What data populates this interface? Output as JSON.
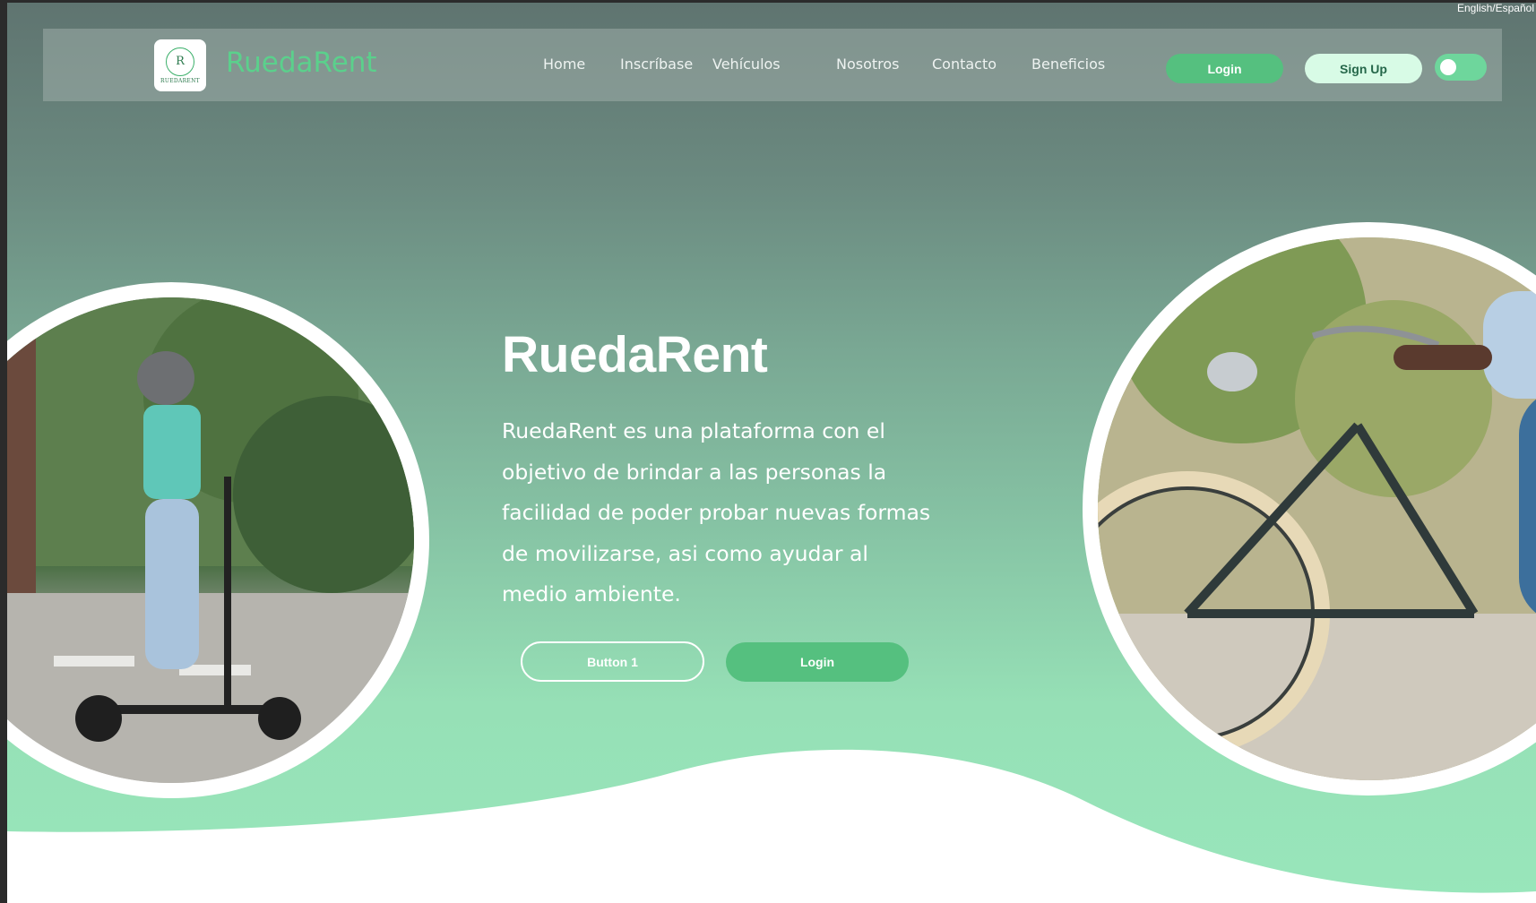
{
  "language_toggle": "English/Español",
  "brand": {
    "logo_letter": "R",
    "logo_subtext": "RUEDARENT",
    "name": "RuedaRent"
  },
  "nav": {
    "links": [
      "Home",
      "Inscríbase",
      "Vehículos",
      "Nosotros",
      "Contacto",
      "Beneficios"
    ],
    "login_label": "Login",
    "signup_label": "Sign Up"
  },
  "hero": {
    "title": "RuedaRent",
    "description": "RuedaRent es una plataforma con el objetivo de brindar a las personas la facilidad de poder probar nuevas formas de movilizarse, asi como ayudar al medio ambiente.",
    "button1_label": "Button 1",
    "button2_label": "Login"
  },
  "colors": {
    "accent_green": "#55c07f",
    "brand_green": "#5bd08c",
    "signup_bg": "#d8fbe6",
    "wave_white": "#ffffff"
  },
  "icons": {
    "theme_toggle": "toggle-switch"
  }
}
